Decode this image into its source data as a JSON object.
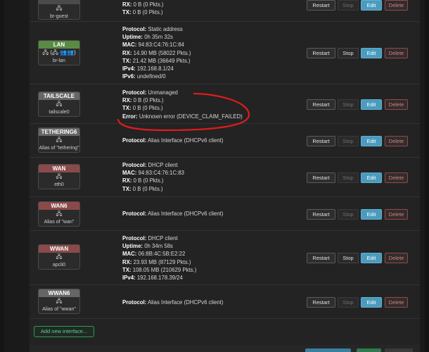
{
  "buttons": {
    "restart": "Restart",
    "stop": "Stop",
    "edit": "Edit",
    "delete": "Delete"
  },
  "add_interface": "Add new interface...",
  "labels": {
    "protocol": "Protocol:",
    "uptime": "Uptime:",
    "mac": "MAC:",
    "rx": "RX:",
    "tx": "TX:",
    "ipv4": "IPv4:",
    "ipv6": "IPv6:",
    "error": "Error:"
  },
  "interfaces": [
    {
      "key": "br-guest",
      "name": "",
      "icons": "🖧",
      "device": "br-guest",
      "header_color": "#4a4a4a",
      "stop_disabled": true,
      "fields": [
        {
          "label": "RX:",
          "value": "0 B (0 Pkts.)"
        },
        {
          "label": "TX:",
          "value": "0 B (0 Pkts.)"
        }
      ]
    },
    {
      "key": "lan",
      "name": "LAN",
      "icons": "🖧 (🖧 👥👥)",
      "device": "br-lan",
      "header_color": "#5b8a45",
      "stop_disabled": false,
      "fields": [
        {
          "label": "Protocol:",
          "value": "Static address"
        },
        {
          "label": "Uptime:",
          "value": "0h 35m 32s"
        },
        {
          "label": "MAC:",
          "value": "94:83:C4:76:1C:84"
        },
        {
          "label": "RX:",
          "value": "14.90 MB (58022 Pkts.)"
        },
        {
          "label": "TX:",
          "value": "21.42 MB (36649 Pkts.)"
        },
        {
          "label": "IPv4:",
          "value": "192.168.8.1/24"
        },
        {
          "label": "IPv6:",
          "value": "undefined/0"
        }
      ]
    },
    {
      "key": "tailscale",
      "name": "TAILSCALE",
      "icons": "🖧",
      "device": "tailscale0",
      "header_color": "#666666",
      "stop_disabled": true,
      "fields": [
        {
          "label": "Protocol:",
          "value": "Unmanaged"
        },
        {
          "label": "RX:",
          "value": "0 B (0 Pkts.)"
        },
        {
          "label": "TX:",
          "value": "0 B (0 Pkts.)"
        },
        {
          "label": "Error:",
          "value": "Unknown error (DEVICE_CLAIM_FAILED)"
        }
      ]
    },
    {
      "key": "tethering6",
      "name": "TETHERING6",
      "icons": "🖧",
      "device": "Alias of \"tethering\"",
      "header_color": "#666666",
      "stop_disabled": true,
      "fields": [
        {
          "label": "Protocol:",
          "value": "Alias Interface (DHCPv6 client)"
        }
      ]
    },
    {
      "key": "wan",
      "name": "WAN",
      "icons": "🖧",
      "device": "eth0",
      "header_color": "#8a4a4a",
      "stop_disabled": true,
      "fields": [
        {
          "label": "Protocol:",
          "value": "DHCP client"
        },
        {
          "label": "MAC:",
          "value": "94:83:C4:76:1C:83"
        },
        {
          "label": "RX:",
          "value": "0 B (0 Pkts.)"
        },
        {
          "label": "TX:",
          "value": "0 B (0 Pkts.)"
        }
      ]
    },
    {
      "key": "wan6",
      "name": "WAN6",
      "icons": "🖧",
      "device": "Alias of \"wan\"",
      "header_color": "#8a4a4a",
      "stop_disabled": true,
      "fields": [
        {
          "label": "Protocol:",
          "value": "Alias Interface (DHCPv6 client)"
        }
      ]
    },
    {
      "key": "wwan",
      "name": "WWAN",
      "icons": "🖧",
      "device": "apcli0",
      "header_color": "#8a4a4a",
      "stop_disabled": false,
      "fields": [
        {
          "label": "Protocol:",
          "value": "DHCP client"
        },
        {
          "label": "Uptime:",
          "value": "0h 34m 58s"
        },
        {
          "label": "MAC:",
          "value": "06:8B:4C:5B:E2:22"
        },
        {
          "label": "RX:",
          "value": "23.93 MB (87129 Pkts.)"
        },
        {
          "label": "TX:",
          "value": "108.05 MB (210629 Pkts.)"
        },
        {
          "label": "IPv4:",
          "value": "192.168.178.39/24"
        }
      ]
    },
    {
      "key": "wwan6",
      "name": "WWAN6",
      "icons": "🖧",
      "device": "Alias of \"wwan\"",
      "header_color": "#666666",
      "stop_disabled": true,
      "fields": [
        {
          "label": "Protocol:",
          "value": "Alias Interface (DHCPv6 client)"
        }
      ]
    }
  ],
  "colors": {
    "edit": "#4a9bbd",
    "delete_border": "#a04545",
    "add_green": "#2f9a5e",
    "annotation_red": "#e01b1b"
  }
}
